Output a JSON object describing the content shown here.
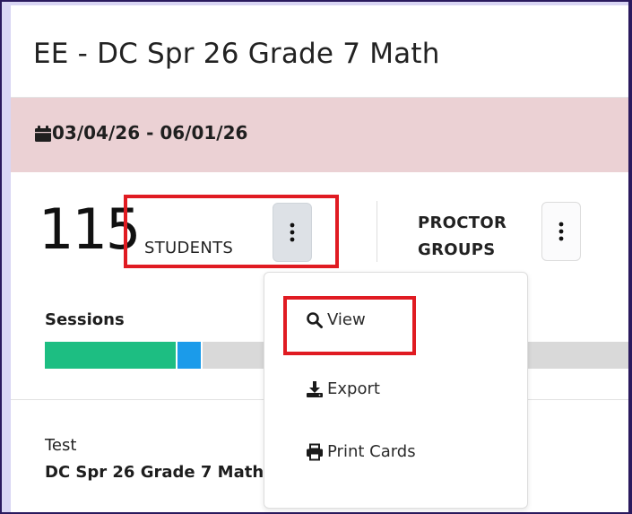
{
  "header": {
    "title": "EE - DC Spr 26 Grade 7 Math"
  },
  "date_range": {
    "icon": "calendar-icon",
    "text": "03/04/26 - 06/01/26"
  },
  "stats": {
    "students_count": "115",
    "students_label": "STUDENTS",
    "proctor_groups_line1": "PROCTOR",
    "proctor_groups_line2": "GROUPS"
  },
  "sessions": {
    "label": "Sessions",
    "progress_colors": {
      "segment_1": "#1dbe82",
      "segment_2": "#1b9bea",
      "remaining": "#d9d9d9"
    }
  },
  "test": {
    "label": "Test",
    "name": "DC Spr 26 Grade 7 Math"
  },
  "students_menu": {
    "items": [
      {
        "label": "View",
        "icon": "search-icon"
      },
      {
        "label": "Export",
        "icon": "download-icon"
      },
      {
        "label": "Print Cards",
        "icon": "print-icon"
      }
    ]
  },
  "colors": {
    "highlight_border": "#e01b22",
    "date_band": "#ebd1d4",
    "outer_frame": "#2a1a5e"
  }
}
